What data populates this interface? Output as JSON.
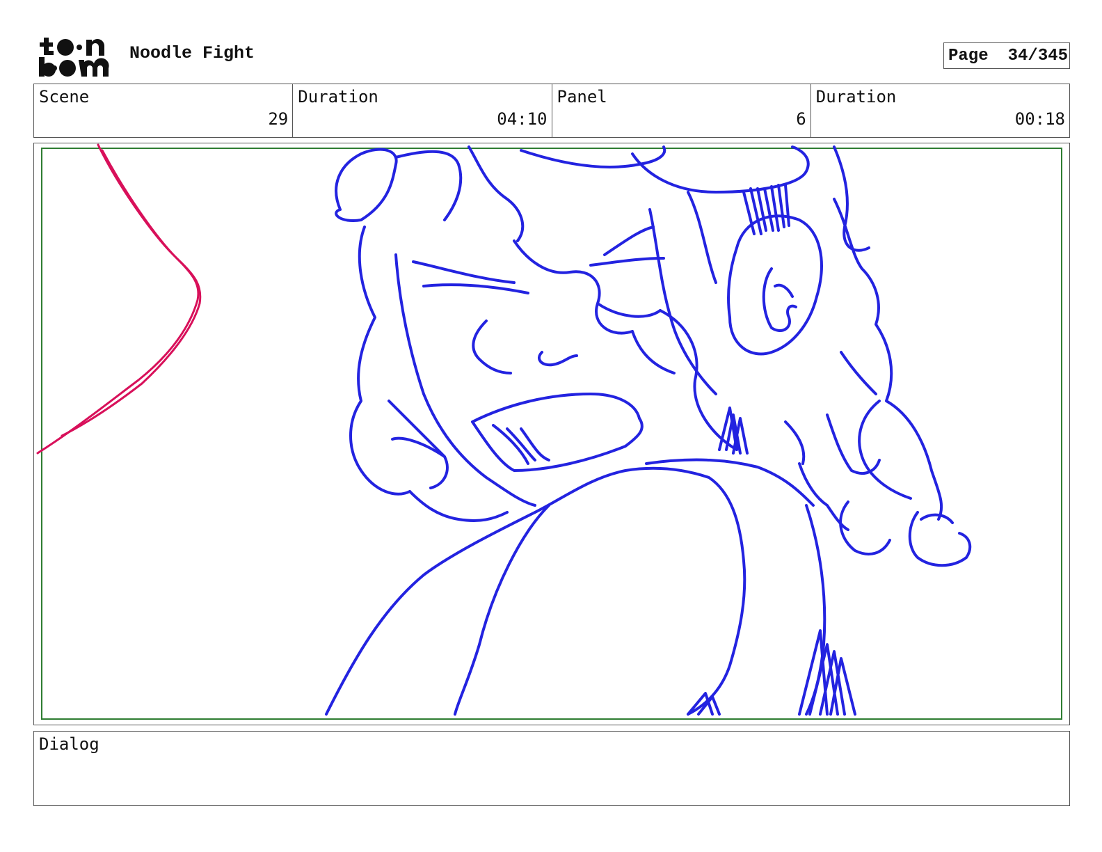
{
  "header": {
    "logo_text": "toon boom",
    "project_title": "Noodle Fight",
    "page_label": "Page",
    "page_number": "34/345"
  },
  "info": {
    "scene_label": "Scene",
    "scene_value": "29",
    "scene_duration_label": "Duration",
    "scene_duration_value": "04:10",
    "panel_label": "Panel",
    "panel_value": "6",
    "panel_duration_label": "Duration",
    "panel_duration_value": "00:18"
  },
  "dialog": {
    "label": "Dialog",
    "text": ""
  },
  "colors": {
    "sketch_primary": "#2323e0",
    "sketch_secondary": "#d8105a",
    "safe_frame": "#2e7d32"
  }
}
